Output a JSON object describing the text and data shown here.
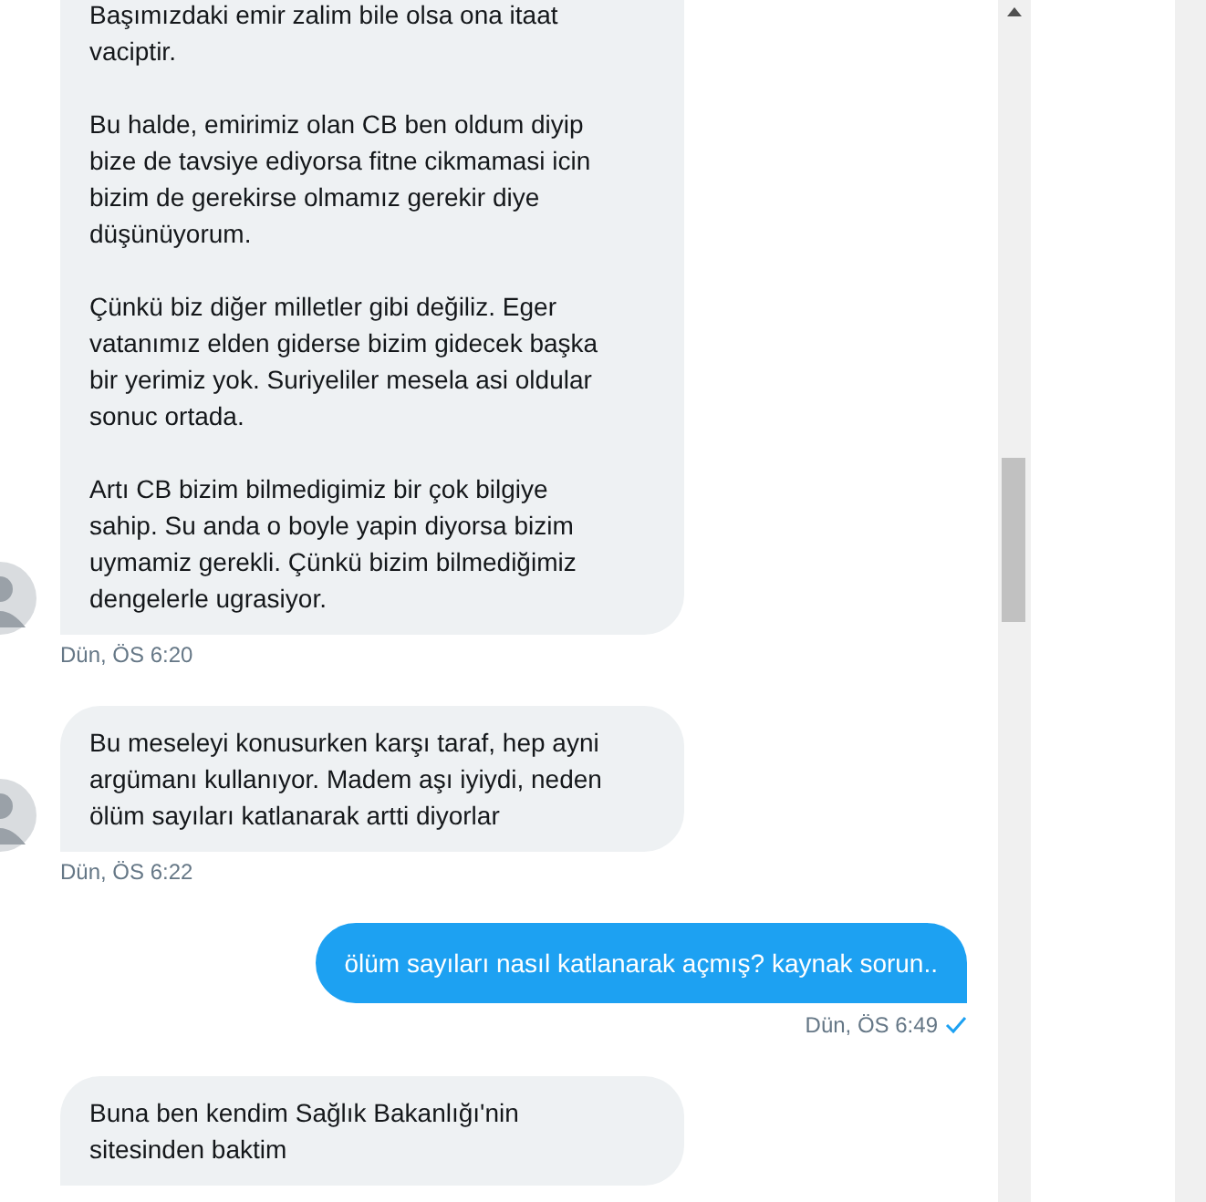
{
  "messages": [
    {
      "kind": "incoming",
      "paragraphs": [
        "Başımızdaki emir zalim bile olsa ona itaat\nvaciptir.",
        "Bu halde, emirimiz olan CB ben oldum diyip\nbize de tavsiye ediyorsa fitne cikmamasi icin\nbizim de gerekirse olmamız gerekir diye\ndüşünüyorum.",
        "Çünkü biz diğer milletler gibi değiliz. Eger\nvatanımız elden giderse bizim gidecek başka\nbir yerimiz yok. Suriyeliler mesela asi oldular\nsonuc ortada.",
        "Artı CB bizim bilmedigimiz bir çok bilgiye\nsahip. Su anda o boyle yapin diyorsa bizim\nuymamiz gerekli. Çünkü bizim bilmediğimiz\ndengelerle ugrasiyor."
      ],
      "show_avatar": true,
      "timestamp": "Dün, ÖS 6:20"
    },
    {
      "kind": "incoming",
      "paragraphs": [
        "Bu meseleyi konusurken karşı taraf, hep ayni\nargümanı kullanıyor. Madem aşı iyiydi, neden\nölüm sayıları katlanarak artti diyorlar"
      ],
      "show_avatar": true,
      "timestamp": "Dün, ÖS 6:22"
    },
    {
      "kind": "outgoing",
      "paragraphs": [
        "ölüm sayıları nasıl katlanarak açmış? kaynak sorun.."
      ],
      "seen": true,
      "timestamp": "Dün, ÖS 6:49"
    },
    {
      "kind": "incoming",
      "paragraphs": [
        "Buna ben kendim Sağlık Bakanlığı'nin\nsitesinden baktim"
      ],
      "show_avatar": false
    }
  ]
}
